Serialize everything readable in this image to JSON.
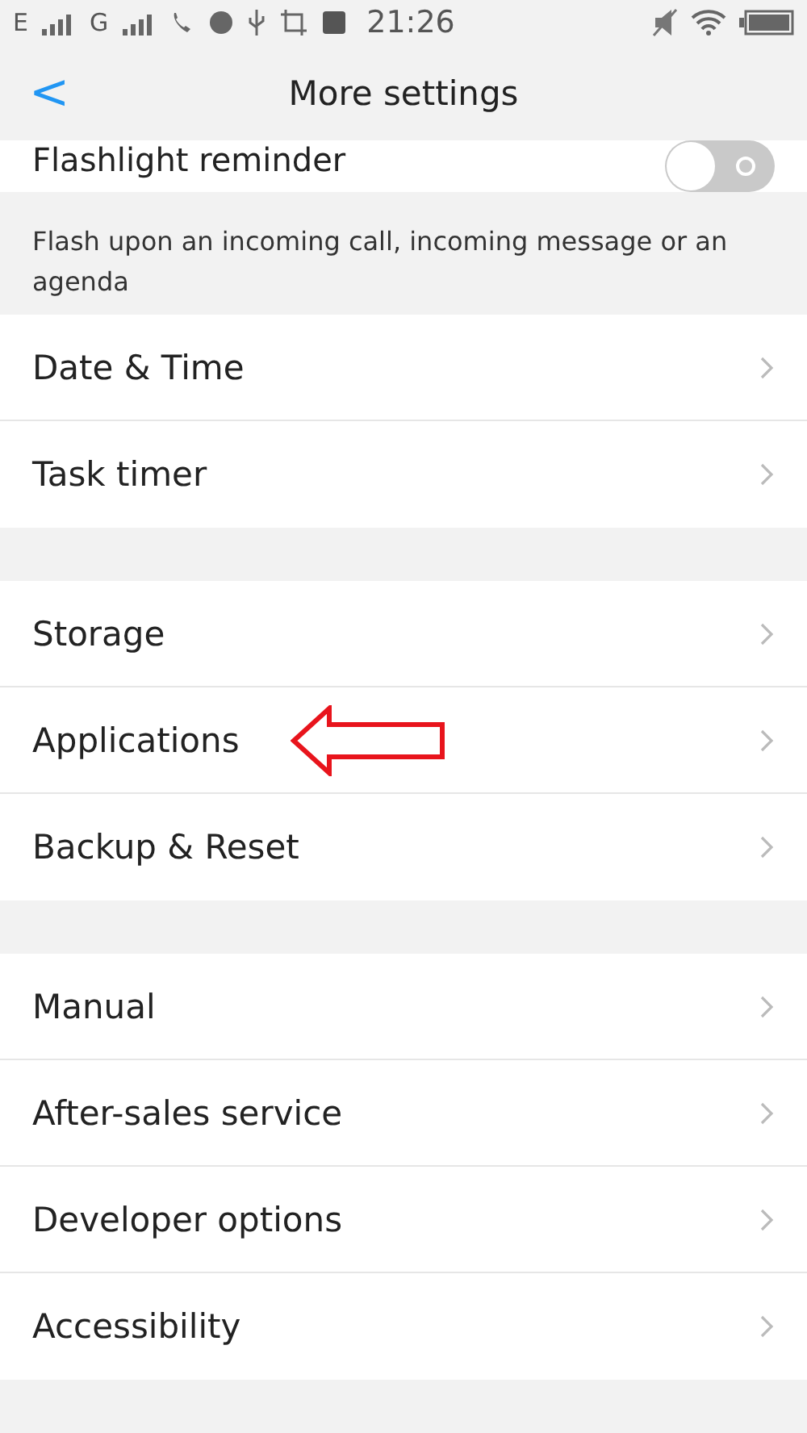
{
  "status_bar": {
    "network_1": "E",
    "network_2": "G",
    "time": "21:26"
  },
  "header": {
    "back": "<",
    "title": "More settings"
  },
  "flashlight": {
    "label": "Flashlight reminder",
    "on": false,
    "description": "Flash upon an incoming call, incoming message or an agenda"
  },
  "groups": [
    {
      "items": [
        {
          "label": "Date & Time",
          "pointed": false
        },
        {
          "label": "Task timer",
          "pointed": false
        }
      ]
    },
    {
      "items": [
        {
          "label": "Storage",
          "pointed": false
        },
        {
          "label": "Applications",
          "pointed": true
        },
        {
          "label": "Backup & Reset",
          "pointed": false
        }
      ]
    },
    {
      "items": [
        {
          "label": "Manual",
          "pointed": false
        },
        {
          "label": "After-sales service",
          "pointed": false
        },
        {
          "label": "Developer options",
          "pointed": false
        },
        {
          "label": "Accessibility",
          "pointed": false
        }
      ]
    }
  ]
}
